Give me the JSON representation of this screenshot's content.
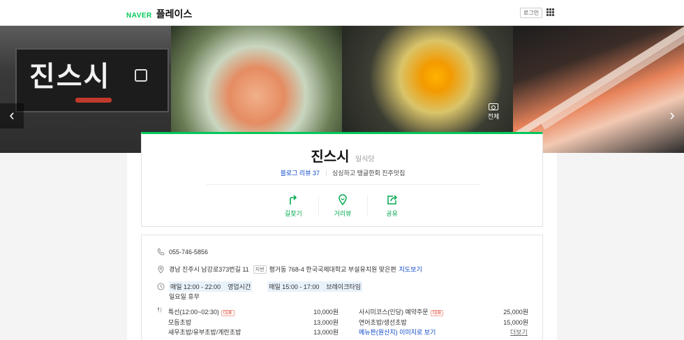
{
  "header": {
    "brand_naver": "NAVER",
    "brand_place": "플레이스",
    "login": "로그인"
  },
  "gallery": {
    "sign_text": "진스시",
    "prev": "‹",
    "next": "›",
    "all_photos": "전체"
  },
  "place": {
    "name": "진스시",
    "category": "일식당",
    "blog_review": "블로그 리뷰 37",
    "tagline": "싱싱하고 탱글한회 진주맛집",
    "actions": [
      {
        "label": "길찾기"
      },
      {
        "label": "거리뷰"
      },
      {
        "label": "공유"
      }
    ]
  },
  "info": {
    "phone": "055-746-5856",
    "address": "경남 진주시 남강로373번길 11",
    "jibun_tag": "지번",
    "jibun": "평거동 768-4 한국국제대학교 부설유치원 맞은편",
    "map_link": "지도보기",
    "hours": [
      {
        "time": "매일 12:00 - 22:00",
        "label": "영업시간"
      },
      {
        "time": "매일 15:00 - 17:00",
        "label": "브레이크타임"
      }
    ],
    "holiday": "일요일 휴무",
    "rep_tag": "대표",
    "menu_left": [
      {
        "name": "특선(12:00~02:30)",
        "price": "10,000원",
        "rep": true
      },
      {
        "name": "모듬초밥",
        "price": "13,000원",
        "rep": false
      },
      {
        "name": "새우초밥/유부초밥/계란초밥",
        "price": "13,000원",
        "rep": false
      }
    ],
    "menu_right": [
      {
        "name": "사시미코스(인당) 예약주문",
        "price": "25,000원",
        "rep": true
      },
      {
        "name": "연어초밥/생선초밥",
        "price": "15,000원",
        "rep": false
      }
    ],
    "menu_image_link": "메뉴판(원산지) 이미지로 보기",
    "more": "더보기"
  },
  "colors": {
    "accent": "#03c75a",
    "link": "#0b47c6"
  }
}
